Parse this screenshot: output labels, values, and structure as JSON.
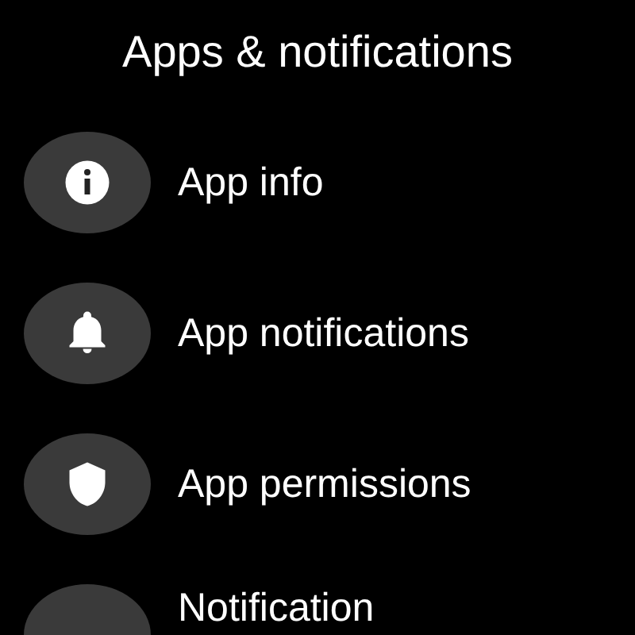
{
  "title": "Apps & notifications",
  "items": [
    {
      "label": "App info"
    },
    {
      "label": "App notifications"
    },
    {
      "label": "App permissions"
    },
    {
      "label": "Notification"
    }
  ]
}
